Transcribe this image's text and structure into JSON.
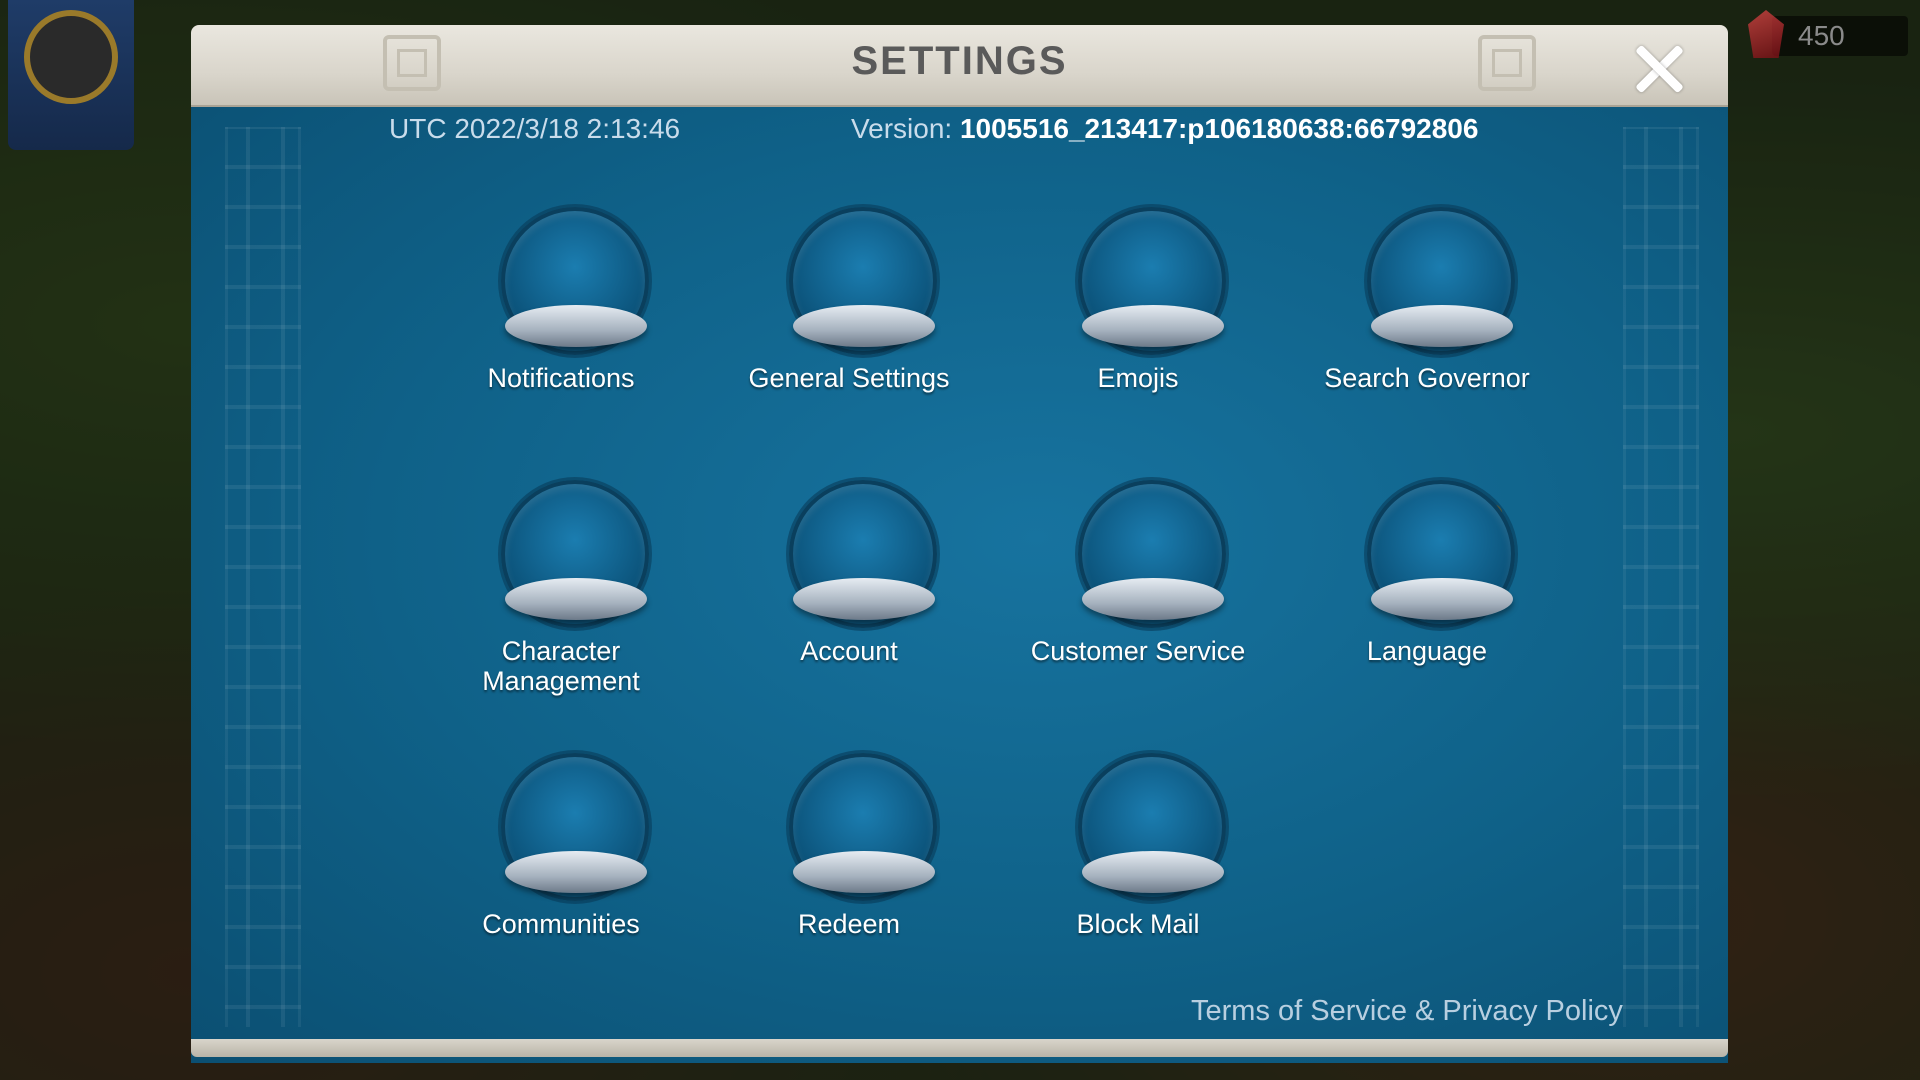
{
  "dialog": {
    "title": "SETTINGS",
    "utc": "UTC 2022/3/18 2:13:46",
    "version_label": "Version:",
    "version_value": "1005516_213417:p106180638:66792806",
    "terms_link": "Terms of Service & Privacy Policy"
  },
  "hud": {
    "gem_count": "450"
  },
  "items": [
    {
      "id": "notifications",
      "label": "Notifications",
      "icon": "bell-icon"
    },
    {
      "id": "general-settings",
      "label": "General Settings",
      "icon": "gears-icon"
    },
    {
      "id": "emojis",
      "label": "Emojis",
      "icon": "emoji-face-icon"
    },
    {
      "id": "search-governor",
      "label": "Search Governor",
      "icon": "search-person-icon"
    },
    {
      "id": "character-management",
      "label": "Character Management",
      "icon": "person-gear-icon"
    },
    {
      "id": "account",
      "label": "Account",
      "icon": "person-icon"
    },
    {
      "id": "customer-service",
      "label": "Customer Service",
      "icon": "question-person-icon"
    },
    {
      "id": "language",
      "label": "Language",
      "icon": "speech-bubble-icon"
    },
    {
      "id": "communities",
      "label": "Communities",
      "icon": "folder-chat-icon"
    },
    {
      "id": "redeem",
      "label": "Redeem",
      "icon": "gift-icon"
    },
    {
      "id": "block-mail",
      "label": "Block Mail",
      "icon": "blocked-mail-icon"
    }
  ],
  "colors": {
    "panel_blue": "#0f6188",
    "title_text": "#5a5a5a",
    "label_text": "#ffffff",
    "pedestal": "#a6b2bf",
    "gold": "#f2b21c",
    "blue_gear": "#1f8fe8",
    "red_block": "#e0222a"
  }
}
